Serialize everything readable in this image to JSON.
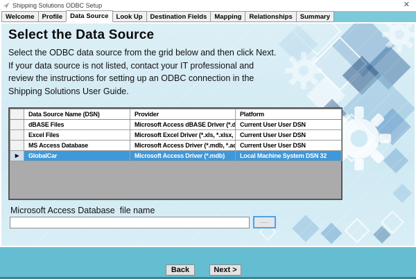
{
  "window": {
    "title": "Shipping Solutions ODBC Setup",
    "close": "✕"
  },
  "tabs": [
    {
      "label": "Welcome"
    },
    {
      "label": "Profile"
    },
    {
      "label": "Data Source",
      "active": true
    },
    {
      "label": "Look Up"
    },
    {
      "label": "Destination Fields"
    },
    {
      "label": "Mapping"
    },
    {
      "label": "Relationships"
    },
    {
      "label": "Summary"
    }
  ],
  "page": {
    "heading": "Select the Data Source",
    "description_lines": [
      "Select the ODBC data source from the grid below and then click Next.",
      "If your data source is not listed, contact your IT professional and",
      "review the instructions for setting up an ODBC connection in the",
      "Shipping Solutions User Guide."
    ]
  },
  "grid": {
    "selection_marker": "▶",
    "columns": [
      "Data Source Name (DSN)",
      "Provider",
      "Platform"
    ],
    "rows": [
      {
        "dsn": "dBASE Files",
        "provider": "Microsoft Access dBASE Driver (*.dbf...",
        "platform": "Current User User DSN"
      },
      {
        "dsn": "Excel Files",
        "provider": "Microsoft Excel Driver (*.xls, *.xlsx, *...",
        "platform": "Current User User DSN"
      },
      {
        "dsn": "MS Access Database",
        "provider": "Microsoft Access Driver (*.mdb, *.acc...",
        "platform": "Current User User DSN"
      },
      {
        "dsn": "GlobalCar",
        "provider": "Microsoft Access Driver (*.mdb)",
        "platform": "Local Machine System DSN 32",
        "selected": true
      }
    ]
  },
  "file_section": {
    "label": "Microsoft Access Database  file name",
    "value": "",
    "browse_label": "....."
  },
  "footer": {
    "back": "Back",
    "next": "Next >"
  },
  "colors": {
    "selected_row": "#3F98D9",
    "footer_bar": "#65BDD2",
    "footer_edge": "#3E8296",
    "tab_filler": "#7CC9DA",
    "grid_empty": "#ABABAB",
    "content_top": "#DCEFF6"
  }
}
